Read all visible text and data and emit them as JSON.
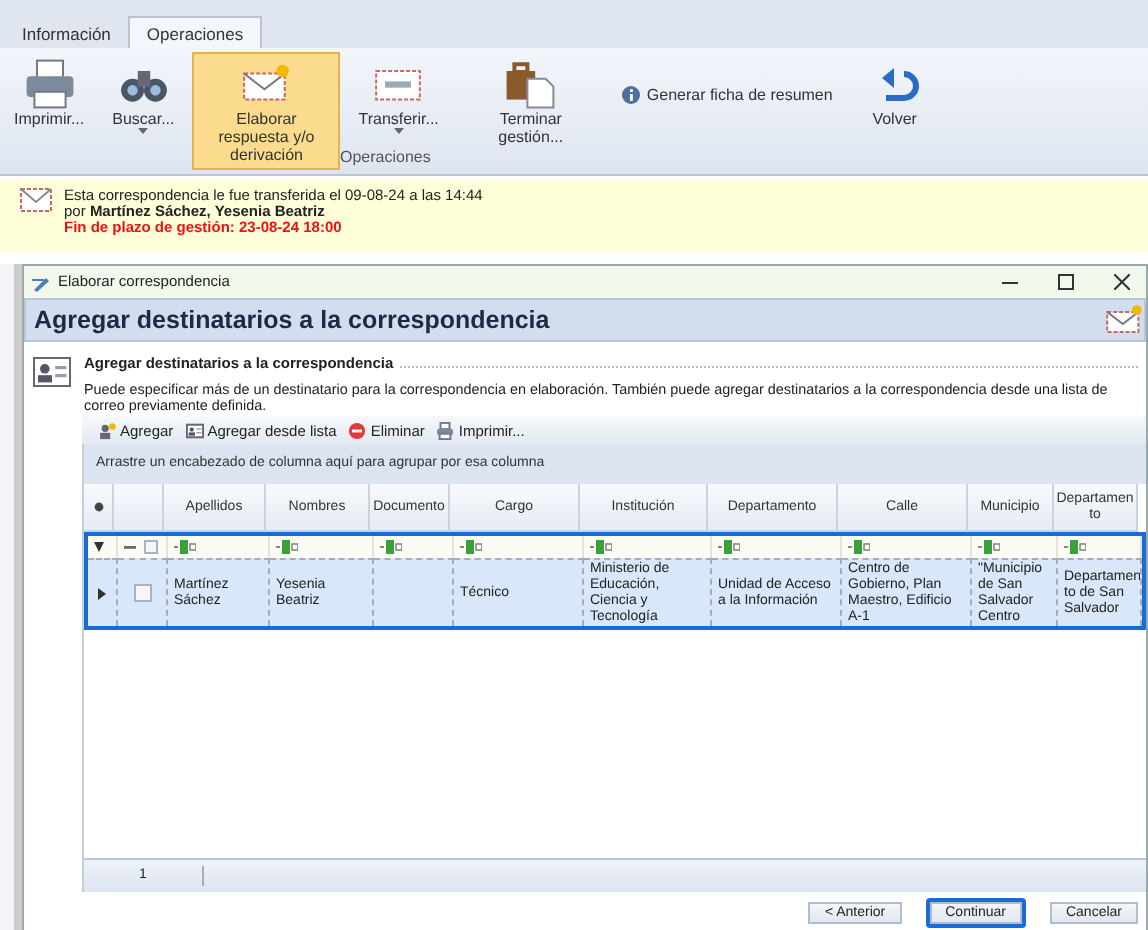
{
  "app_tabs": [
    {
      "label": "Información",
      "selected": false
    },
    {
      "label": "Operaciones",
      "selected": true
    }
  ],
  "ribbon": {
    "buttons": [
      {
        "label": "Imprimir...",
        "selected": false,
        "dropdown": false
      },
      {
        "label": "Buscar...",
        "selected": false,
        "dropdown": true
      },
      {
        "label": "Elaborar respuesta y/o derivación",
        "selected": true,
        "dropdown": false
      },
      {
        "label": "Transferir...",
        "selected": false,
        "dropdown": true
      },
      {
        "label": "Terminar gestión...",
        "selected": false,
        "dropdown": false
      }
    ],
    "link": "Generar ficha de resumen",
    "back": {
      "label": "Volver"
    },
    "group_label": "Operaciones"
  },
  "notification": {
    "message": "Esta correspondencia le fue transferida el 09-08-24 a las 14:44",
    "by": "por **Martínez Sáchez, Yesenia Beatriz**",
    "deadline": "Fin de plazo de gestión: 23-08-24 18:00"
  },
  "dialog": {
    "title": "Elaborar correspondencia",
    "header": "Agregar destinatarios a la correspondencia",
    "section_title": "Agregar destinatarios a la correspondencia",
    "description": "Puede especificar más de un destinatario para la correspondencia en elaboración. También puede agregar destinatarios a la correspondencia desde una lista de correo previamente definida.",
    "toolbar": [
      {
        "label": "Agregar"
      },
      {
        "label": "Agregar desde lista"
      },
      {
        "label": "Eliminar"
      },
      {
        "label": "Imprimir..."
      }
    ],
    "select_all_checked": false,
    "group_hint": "Arrastre un encabezado de columna aquí para agrupar por esa columna",
    "columns": [
      "Apellidos",
      "Nombres",
      "Documento",
      "Cargo",
      "Institución",
      "Departamento",
      "Calle",
      "Municipio",
      "Departamen to"
    ],
    "rows": [
      {
        "selected": true,
        "checked": false,
        "cells": [
          "Martínez Sáchez",
          "Yesenia Beatriz",
          "",
          "Técnico",
          "Ministerio de Educación, Ciencia y Tecnología",
          "Unidad de Acceso a la Información",
          "Centro de Gobierno, Plan Maestro, Edificio A-1",
          "\"Municipio de San Salvador Centro",
          "Departamen to de San Salvador"
        ]
      }
    ],
    "footer_count": "1",
    "buttons": [
      {
        "label": "< Anterior",
        "focused": false
      },
      {
        "label": "Continuar",
        "focused": true
      },
      {
        "label": "Cancelar",
        "focused": false
      }
    ]
  }
}
